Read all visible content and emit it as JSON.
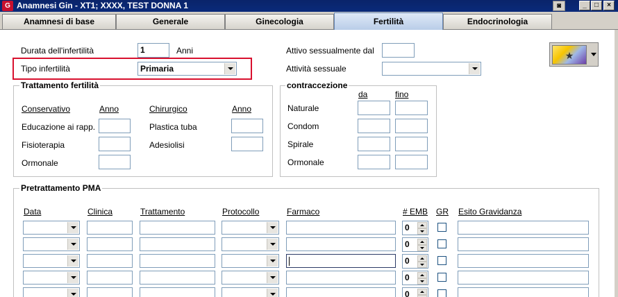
{
  "window": {
    "title": "Anamnesi Gin - XT1; XXXX, TEST DONNA 1",
    "app_icon": "app-logo-icon",
    "camera_icon": "camera-icon",
    "buttons": {
      "minimize": "_",
      "maximize": "□",
      "close": "×"
    }
  },
  "tabs": [
    {
      "label": "Anamnesi di base",
      "active": false
    },
    {
      "label": "Generale",
      "active": false
    },
    {
      "label": "Ginecologia",
      "active": false
    },
    {
      "label": "Fertilità",
      "active": true
    },
    {
      "label": "Endocrinologia",
      "active": false
    }
  ],
  "fertility": {
    "durata_label": "Durata dell'infertilità",
    "durata_value": "1",
    "durata_unit": "Anni",
    "tipo_label": "Tipo infertilità",
    "tipo_value": "Primaria",
    "attivo_label": "Attivo sessualmente dal",
    "attivo_value": "",
    "attivita_label": "Attività sessuale",
    "attivita_value": ""
  },
  "trattamento": {
    "title": "Trattamento fertilità",
    "col_conservativo": "Conservativo",
    "col_anno": "Anno",
    "col_chirurgico": "Chirurgico",
    "col_anno2": "Anno",
    "conservativo_items": [
      "Educazione ai rapp.",
      "Fisioterapia",
      "Ormonale"
    ],
    "chirurgico_items": [
      "Plastica tuba",
      "Adesiolisi"
    ]
  },
  "contraccezione": {
    "title": "contraccezione",
    "col_da": "da",
    "col_fino": "fino",
    "items": [
      "Naturale",
      "Condom",
      "Spirale",
      "Ormonale"
    ]
  },
  "pma": {
    "title": "Pretrattamento PMA",
    "headers": {
      "data": "Data",
      "clinica": "Clinica",
      "trattamento": "Trattamento",
      "protocollo": "Protocollo",
      "farmaco": "Farmaco",
      "emb": "# EMB",
      "gr": "GR",
      "esito": "Esito Gravidanza"
    },
    "rows": [
      {
        "emb": "0"
      },
      {
        "emb": "0"
      },
      {
        "emb": "0"
      },
      {
        "emb": "0"
      },
      {
        "emb": "0"
      }
    ]
  }
}
